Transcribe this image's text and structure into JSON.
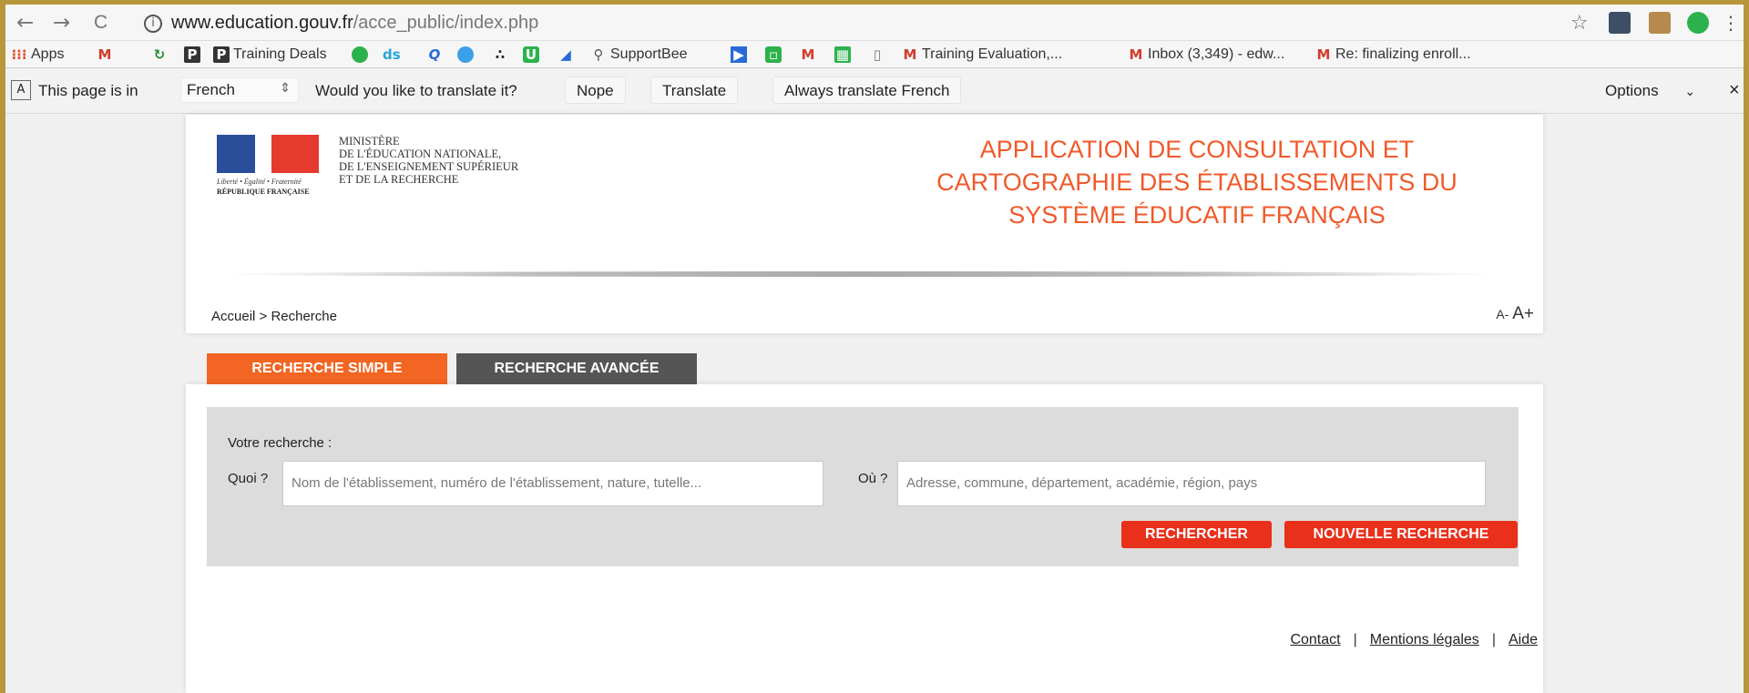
{
  "browser": {
    "url_host": "www.education.gouv.fr",
    "url_path": "/acce_public/index.php",
    "back_icon": "←",
    "forward_icon": "→",
    "reload_icon": "C",
    "info_icon": "i",
    "star_icon": "☆",
    "menu_icon": "⋮"
  },
  "bookmarks": {
    "apps": "Apps",
    "training_deals": "Training Deals",
    "ds": "ds",
    "q": "Q",
    "supportbee": "SupportBee",
    "training_eval": "Training Evaluation,...",
    "inbox": "Inbox (3,349) - edw...",
    "re_finalizing": "Re: finalizing enroll..."
  },
  "translate_bar": {
    "prefix": "This page is in",
    "language": "French",
    "question": "Would you like to translate it?",
    "nope": "Nope",
    "translate": "Translate",
    "always": "Always translate French",
    "options": "Options",
    "close": "×"
  },
  "site": {
    "logo": {
      "motto": "Liberté • Égalité • Fraternité",
      "republic": "RÉPUBLIQUE FRANÇAISE"
    },
    "ministry_lines": [
      "Ministère",
      "de l'Éducation nationale,",
      "de l'Enseignement supérieur",
      "et de la Recherche"
    ],
    "app_title_lines": [
      "APPLICATION DE CONSULTATION ET",
      "CARTOGRAPHIE DES ÉTABLISSEMENTS DU",
      "SYSTÈME ÉDUCATIF FRANÇAIS"
    ],
    "breadcrumb": "Accueil > Recherche",
    "font_smaller": "A-",
    "font_larger": "A+",
    "tabs": {
      "simple": "RECHERCHE SIMPLE",
      "advanced": "RECHERCHE AVANCÉE"
    },
    "search": {
      "title": "Votre recherche :",
      "what_label": "Quoi ?",
      "what_placeholder": "Nom de l'établissement, numéro de l'établissement, nature, tutelle...",
      "where_label": "Où ?",
      "where_placeholder": "Adresse, commune, département, académie, région, pays",
      "search_button": "RECHERCHER",
      "new_search_button": "NOUVELLE RECHERCHE"
    },
    "footer": {
      "contact": "Contact",
      "legal": "Mentions légales",
      "help": "Aide",
      "separator": "|"
    }
  },
  "colors": {
    "accent_orange": "#f26522",
    "title_orange": "#f1592a",
    "button_red": "#e8301a",
    "tab_dark": "#555555"
  }
}
